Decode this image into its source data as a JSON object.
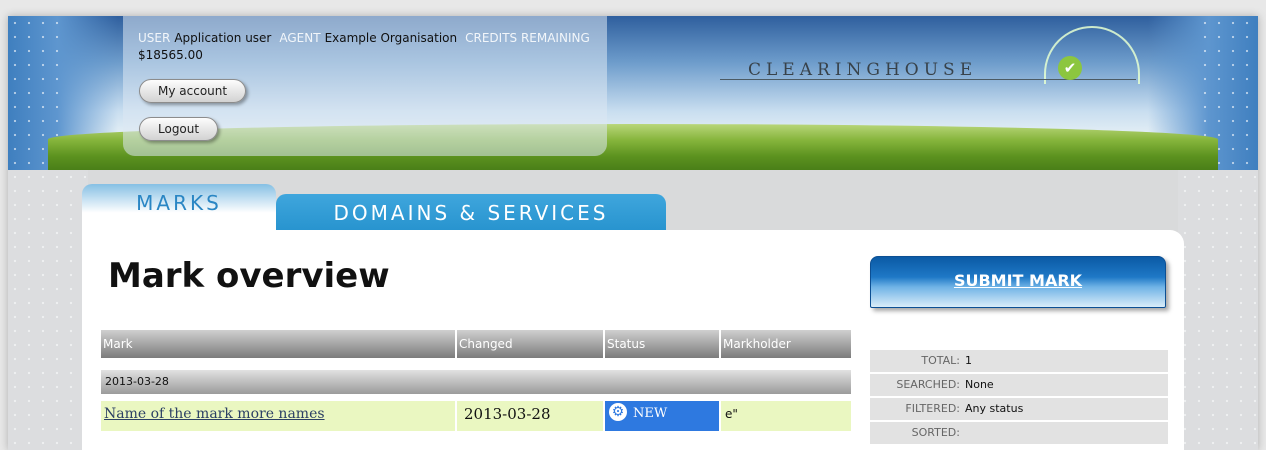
{
  "header": {
    "user_label": "USER",
    "user_value": "Application user",
    "agent_label": "AGENT",
    "agent_value": "Example Organisation",
    "credits_label": "CREDITS REMAINING",
    "credits_value": "$18565.00",
    "my_account": "My account",
    "logout": "Logout",
    "logo_text": "CLEARINGHOUSE"
  },
  "tabs": [
    {
      "label": "MARKS",
      "active": true
    },
    {
      "label": "DOMAINS & SERVICES",
      "active": false
    }
  ],
  "main": {
    "title": "Mark overview",
    "submit_label": "SUBMIT MARK",
    "table": {
      "columns": [
        "Mark",
        "Changed",
        "Status",
        "Markholder"
      ],
      "group_label": "2013-03-28",
      "rows": [
        {
          "mark": "Name of the mark more names",
          "changed": "2013-03-28",
          "status": "NEW",
          "markholder": "e\""
        }
      ]
    }
  },
  "stats": [
    {
      "label": "TOTAL:",
      "value": "1"
    },
    {
      "label": "SEARCHED:",
      "value": "None"
    },
    {
      "label": "FILTERED:",
      "value": "Any status"
    },
    {
      "label": "SORTED:",
      "value": ""
    }
  ],
  "colors": {
    "tab_active_text": "#2a86c4",
    "tab_inactive_bg": "#2894cf",
    "row_bg": "#eaf7c1",
    "status_new_bg": "#2e79e0",
    "submit_bg": "#1e78c6"
  }
}
